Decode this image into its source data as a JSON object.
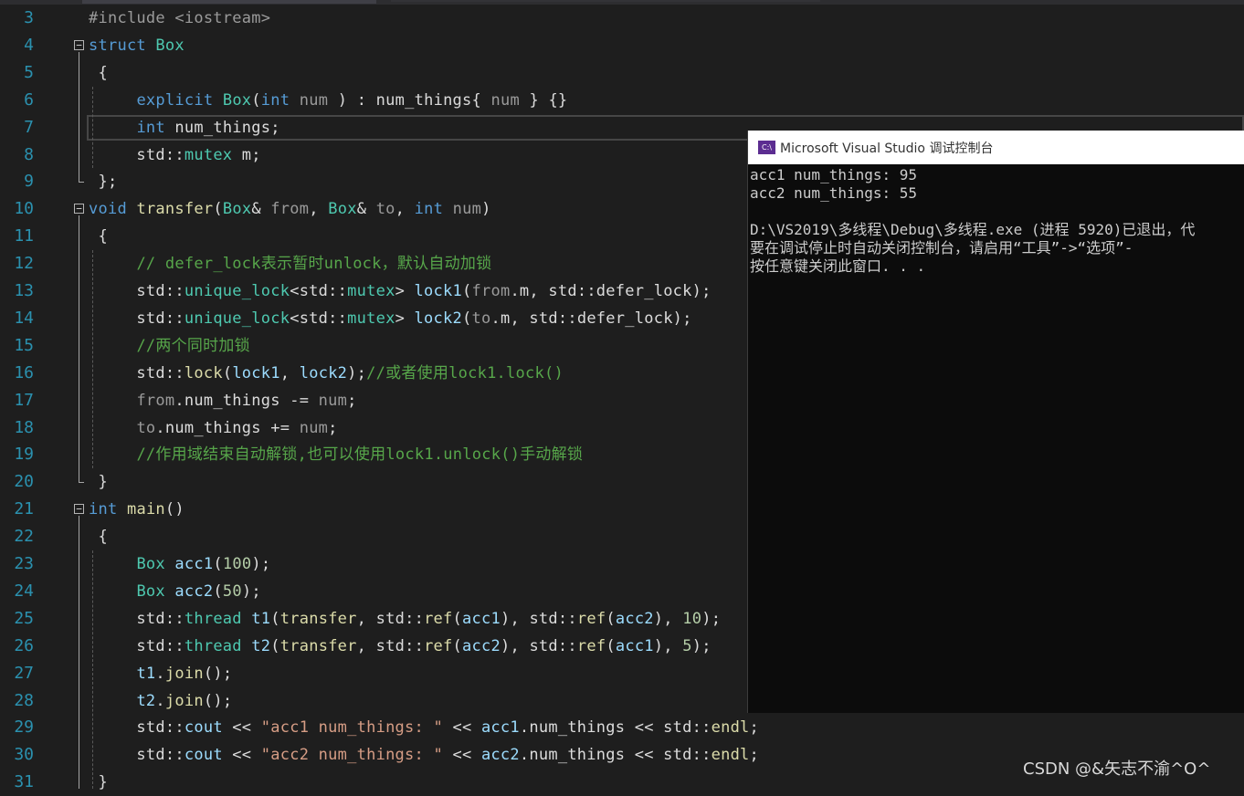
{
  "lines": [
    {
      "n": "3",
      "segs": [
        [
          "pp",
          "#include <iostream>"
        ]
      ]
    },
    {
      "n": "4",
      "fold": true,
      "segs": [
        [
          "kw",
          "struct"
        ],
        [
          "",
          " "
        ],
        [
          "ty",
          "Box"
        ]
      ]
    },
    {
      "n": "5",
      "segs": [
        [
          "",
          " {"
        ]
      ]
    },
    {
      "n": "6",
      "segs": [
        [
          "",
          "     "
        ],
        [
          "kw",
          "explicit"
        ],
        [
          "",
          " "
        ],
        [
          "ty",
          "Box"
        ],
        [
          "",
          "("
        ],
        [
          "kw",
          "int"
        ],
        [
          "",
          " "
        ],
        [
          "pa",
          "num"
        ],
        [
          "",
          " ) : "
        ],
        [
          "mem",
          "num_things"
        ],
        [
          "",
          "{ "
        ],
        [
          "pa",
          "num"
        ],
        [
          "",
          " } {}"
        ]
      ]
    },
    {
      "n": "7",
      "segs": [
        [
          "",
          "     "
        ],
        [
          "kw",
          "int"
        ],
        [
          "",
          " num_things;"
        ]
      ]
    },
    {
      "n": "8",
      "segs": [
        [
          "",
          "     std::"
        ],
        [
          "ty",
          "mutex"
        ],
        [
          "",
          " m;"
        ]
      ]
    },
    {
      "n": "9",
      "segs": [
        [
          "",
          " };"
        ]
      ]
    },
    {
      "n": "10",
      "fold": true,
      "segs": [
        [
          "kw",
          "void"
        ],
        [
          "",
          " "
        ],
        [
          "fn",
          "transfer"
        ],
        [
          "",
          "("
        ],
        [
          "ty",
          "Box"
        ],
        [
          "",
          "& "
        ],
        [
          "pa",
          "from"
        ],
        [
          ", "
        ],
        [
          "ty",
          "Box"
        ],
        [
          "",
          "& "
        ],
        [
          "pa",
          "to"
        ],
        [
          "",
          ", "
        ],
        [
          "kw",
          "int"
        ],
        [
          "",
          " "
        ],
        [
          "pa",
          "num"
        ],
        [
          "",
          ")"
        ]
      ]
    },
    {
      "n": "11",
      "segs": [
        [
          "",
          " {"
        ]
      ]
    },
    {
      "n": "12",
      "segs": [
        [
          "",
          "     "
        ],
        [
          "cm",
          "// defer_lock表示暂时unlock，默认自动加锁"
        ]
      ]
    },
    {
      "n": "13",
      "segs": [
        [
          "",
          "     std::"
        ],
        [
          "ty",
          "unique_lock"
        ],
        [
          "",
          "<std::"
        ],
        [
          "ty",
          "mutex"
        ],
        [
          "",
          "> "
        ],
        [
          "lv",
          "lock1"
        ],
        [
          "",
          "("
        ],
        [
          "pa",
          "from"
        ],
        [
          "",
          ".m, std::defer_lock);"
        ]
      ]
    },
    {
      "n": "14",
      "segs": [
        [
          "",
          "     std::"
        ],
        [
          "ty",
          "unique_lock"
        ],
        [
          "",
          "<std::"
        ],
        [
          "ty",
          "mutex"
        ],
        [
          "",
          "> "
        ],
        [
          "lv",
          "lock2"
        ],
        [
          "",
          "("
        ],
        [
          "pa",
          "to"
        ],
        [
          "",
          ".m, std::defer_lock);"
        ]
      ]
    },
    {
      "n": "15",
      "segs": [
        [
          "",
          "     "
        ],
        [
          "cm",
          "//两个同时加锁"
        ]
      ]
    },
    {
      "n": "16",
      "segs": [
        [
          "",
          "     std::"
        ],
        [
          "fn",
          "lock"
        ],
        [
          "",
          "("
        ],
        [
          "lv",
          "lock1"
        ],
        [
          "",
          ", "
        ],
        [
          "lv",
          "lock2"
        ],
        [
          "",
          ");"
        ],
        [
          "cm",
          "//或者使用lock1.lock()"
        ]
      ]
    },
    {
      "n": "17",
      "segs": [
        [
          "",
          "     "
        ],
        [
          "pa",
          "from"
        ],
        [
          "",
          ".num_things -= "
        ],
        [
          "pa",
          "num"
        ],
        [
          "",
          ";"
        ]
      ]
    },
    {
      "n": "18",
      "segs": [
        [
          "",
          "     "
        ],
        [
          "pa",
          "to"
        ],
        [
          "",
          ".num_things += "
        ],
        [
          "pa",
          "num"
        ],
        [
          "",
          ";"
        ]
      ]
    },
    {
      "n": "19",
      "segs": [
        [
          "",
          "     "
        ],
        [
          "cm",
          "//作用域结束自动解锁,也可以使用lock1.unlock()手动解锁"
        ]
      ]
    },
    {
      "n": "20",
      "segs": [
        [
          "",
          " }"
        ]
      ]
    },
    {
      "n": "21",
      "fold": true,
      "segs": [
        [
          "kw",
          "int"
        ],
        [
          "",
          " "
        ],
        [
          "fn",
          "main"
        ],
        [
          "",
          "()"
        ]
      ]
    },
    {
      "n": "22",
      "segs": [
        [
          "",
          " {"
        ]
      ]
    },
    {
      "n": "23",
      "segs": [
        [
          "",
          "     "
        ],
        [
          "ty",
          "Box"
        ],
        [
          "",
          " "
        ],
        [
          "lv",
          "acc1"
        ],
        [
          "",
          "("
        ],
        [
          "num",
          "100"
        ],
        [
          "",
          ");"
        ]
      ]
    },
    {
      "n": "24",
      "segs": [
        [
          "",
          "     "
        ],
        [
          "ty",
          "Box"
        ],
        [
          "",
          " "
        ],
        [
          "lv",
          "acc2"
        ],
        [
          "",
          "("
        ],
        [
          "num",
          "50"
        ],
        [
          "",
          ");"
        ]
      ]
    },
    {
      "n": "25",
      "segs": [
        [
          "",
          "     std::"
        ],
        [
          "ty",
          "thread"
        ],
        [
          "",
          " "
        ],
        [
          "lv",
          "t1"
        ],
        [
          "",
          "("
        ],
        [
          "fn",
          "transfer"
        ],
        [
          "",
          ", std::"
        ],
        [
          "fn",
          "ref"
        ],
        [
          "",
          "("
        ],
        [
          "lv",
          "acc1"
        ],
        [
          "",
          "), std::"
        ],
        [
          "fn",
          "ref"
        ],
        [
          "",
          "("
        ],
        [
          "lv",
          "acc2"
        ],
        [
          "",
          "), "
        ],
        [
          "num",
          "10"
        ],
        [
          "",
          ");"
        ]
      ]
    },
    {
      "n": "26",
      "segs": [
        [
          "",
          "     std::"
        ],
        [
          "ty",
          "thread"
        ],
        [
          "",
          " "
        ],
        [
          "lv",
          "t2"
        ],
        [
          "",
          "("
        ],
        [
          "fn",
          "transfer"
        ],
        [
          "",
          ", std::"
        ],
        [
          "fn",
          "ref"
        ],
        [
          "",
          "("
        ],
        [
          "lv",
          "acc2"
        ],
        [
          "",
          "), std::"
        ],
        [
          "fn",
          "ref"
        ],
        [
          "",
          "("
        ],
        [
          "lv",
          "acc1"
        ],
        [
          "",
          "), "
        ],
        [
          "num",
          "5"
        ],
        [
          "",
          ");"
        ]
      ]
    },
    {
      "n": "27",
      "segs": [
        [
          "",
          "     "
        ],
        [
          "lv",
          "t1"
        ],
        [
          "",
          "."
        ],
        [
          "fn",
          "join"
        ],
        [
          "",
          "();"
        ]
      ]
    },
    {
      "n": "28",
      "segs": [
        [
          "",
          "     "
        ],
        [
          "lv",
          "t2"
        ],
        [
          "",
          "."
        ],
        [
          "fn",
          "join"
        ],
        [
          "",
          "();"
        ]
      ]
    },
    {
      "n": "29",
      "segs": [
        [
          "",
          "     std::"
        ],
        [
          "lv",
          "cout"
        ],
        [
          "",
          " << "
        ],
        [
          "str",
          "\"acc1 num_things: \""
        ],
        [
          "",
          " << "
        ],
        [
          "lv",
          "acc1"
        ],
        [
          "",
          ".num_things << std::"
        ],
        [
          "fn",
          "endl"
        ],
        [
          "",
          ";"
        ]
      ]
    },
    {
      "n": "30",
      "segs": [
        [
          "",
          "     std::"
        ],
        [
          "lv",
          "cout"
        ],
        [
          "",
          " << "
        ],
        [
          "str",
          "\"acc2 num_things: \""
        ],
        [
          "",
          " << "
        ],
        [
          "lv",
          "acc2"
        ],
        [
          "",
          ".num_things << std::"
        ],
        [
          "fn",
          "endl"
        ],
        [
          "",
          ";"
        ]
      ]
    },
    {
      "n": "31",
      "segs": [
        [
          "",
          " }"
        ]
      ]
    }
  ],
  "console": {
    "icon": "C:\\",
    "title": "Microsoft Visual Studio 调试控制台",
    "lines": [
      "acc1 num_things: 95",
      "acc2 num_things: 55",
      "",
      "D:\\VS2019\\多线程\\Debug\\多线程.exe (进程 5920)已退出，代",
      "要在调试停止时自动关闭控制台，请启用“工具”->“选项”-",
      "按任意键关闭此窗口. . ."
    ]
  },
  "watermark": "CSDN @&矢志不渝^O^"
}
